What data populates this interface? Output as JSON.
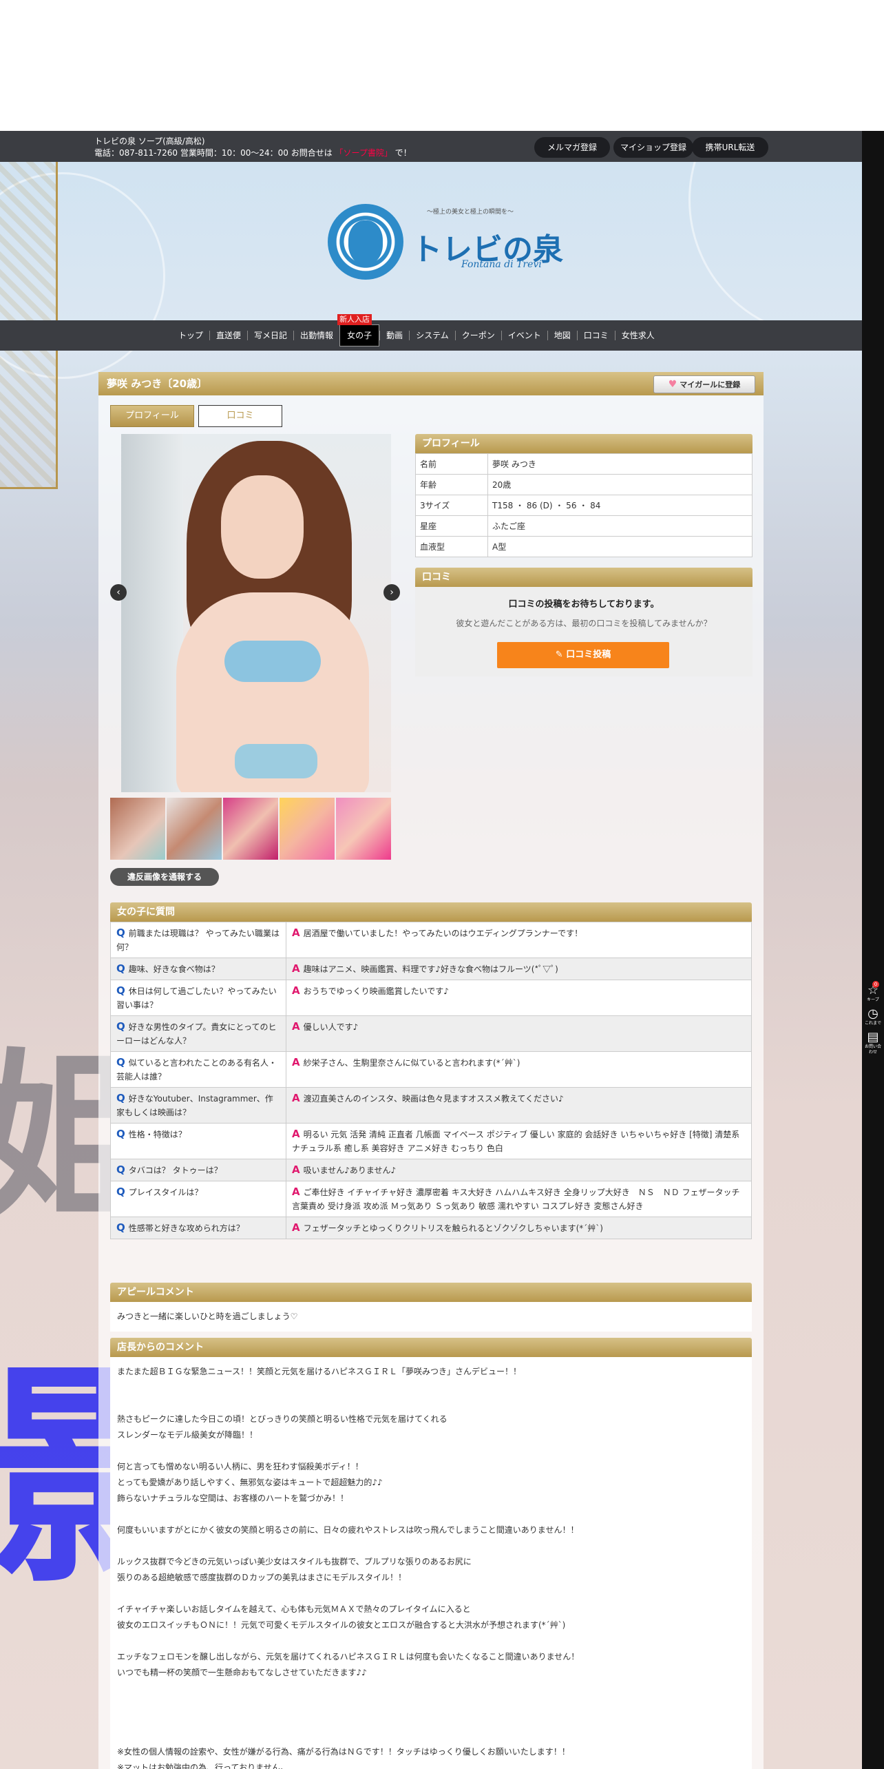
{
  "topbar": {
    "line1": "トレビの泉 ソープ(高級/高松)",
    "line2_prefix": "電話：087-811-7260 営業時間：10：00～24：00 お問合せは",
    "line2_highlight": "「ソープ書院」",
    "line2_suffix": "で！",
    "buttons": [
      "メルマガ登録",
      "マイショップ登録",
      "携帯URL転送"
    ]
  },
  "logo": {
    "tagline": "〜極上の美女と極上の瞬間を〜",
    "name": "トレビの泉",
    "en": "Fontana di Trevi"
  },
  "nav": {
    "items": [
      "トップ",
      "直送便",
      "写メ日記",
      "出勤情報",
      "女の子",
      "動画",
      "システム",
      "クーポン",
      "イベント",
      "地図",
      "口コミ",
      "女性求人"
    ],
    "new_badge": "新人入店"
  },
  "profile": {
    "title": "夢咲 みつき〔20歳〕",
    "mygirl_button": "マイガールに登録",
    "tabs": [
      "プロフィール",
      "口コミ"
    ],
    "report_button": "違反画像を通報する",
    "section_title": "プロフィール",
    "rows": [
      {
        "k": "名前",
        "v": "夢咲 みつき"
      },
      {
        "k": "年齢",
        "v": "20歳"
      },
      {
        "k": "3サイズ",
        "v": "T158 ・ 86 (D) ・ 56 ・ 84"
      },
      {
        "k": "星座",
        "v": "ふたご座"
      },
      {
        "k": "血液型",
        "v": "A型"
      }
    ]
  },
  "review": {
    "title": "口コミ",
    "message": "口コミの投稿をお待ちしております。",
    "sub": "彼女と遊んだことがある方は、最初の口コミを投稿してみませんか？",
    "button": "口コミ投稿"
  },
  "qa": {
    "title": "女の子に質問",
    "rows": [
      {
        "q": "前職または現職は？ やってみたい職業は何？",
        "a": "居酒屋で働いていました！やってみたいのはウエディングプランナーです！"
      },
      {
        "q": "趣味、好きな食べ物は？",
        "a": "趣味はアニメ、映画鑑賞、料理です♪好きな食べ物はフルーツ(*ﾟ▽ﾟ)"
      },
      {
        "q": "休日は何して過ごしたい？やってみたい習い事は？",
        "a": "おうちでゆっくり映画鑑賞したいです♪"
      },
      {
        "q": "好きな男性のタイプ。貴女にとってのヒーローはどんな人？",
        "a": "優しい人です♪"
      },
      {
        "q": "似ていると言われたことのある有名人・芸能人は誰？",
        "a": "紗栄子さん、生駒里奈さんに似ていると言われます(*´艸`)"
      },
      {
        "q": "好きなYoutuber、Instagrammer、作家もしくは映画は？",
        "a": "渡辺直美さんのインスタ、映画は色々見ますオススメ教えてください♪"
      },
      {
        "q": "性格・特徴は？",
        "a": "明るい 元気 活発 清純 正直者 几帳面 マイペース ポジティブ 優しい 家庭的 会話好き いちゃいちゃ好き [特徴] 清楚系 ナチュラル系 癒し系 美容好き アニメ好き むっちり 色白"
      },
      {
        "q": "タバコは？ タトゥーは？",
        "a": "吸いません♪ありません♪"
      },
      {
        "q": "プレイスタイルは？",
        "a": "ご奉仕好き イチャイチャ好き 濃厚密着 キス大好き ハムハムキス好き 全身リップ大好き　ＮＳ　ＮＤ フェザータッチ 言葉責め 受け身派 攻め派 Ｍっ気あり Ｓっ気あり 敏感 濡れやすい コスプレ好き 変態さん好き"
      },
      {
        "q": "性感帯と好きな攻められ方は？",
        "a": "フェザータッチとゆっくりクリトリスを触られるとゾクゾクしちゃいます(*´艸`)"
      }
    ]
  },
  "appeal": {
    "title": "アピールコメント",
    "text": "みつきと一緒に楽しいひと時を過ごしましょう♡"
  },
  "manager": {
    "title": "店長からのコメント",
    "text": "またまた超ＢＩＧな緊急ニュース！！笑顔と元気を届けるハピネスＧＩＲＬ「夢咲みつき」さんデビュー！！\n\n\n熱さもピークに達した今日この頃！とびっきりの笑顔と明るい性格で元気を届けてくれる\nスレンダーなモデル級美女が降臨！！\n\n何と言っても憎めない明るい人柄に、男を狂わす悩殺美ボディ！！\nとっても愛嬌があり話しやすく、無邪気な姿はキュートで超超魅力的♪♪\n飾らないナチュラルな空間は、お客様のハートを鷲づかみ！！\n\n何度もいいますがとにかく彼女の笑顔と明るさの前に、日々の疲れやストレスは吹っ飛んでしまうこと間違いありません！！\n\nルックス抜群で今どきの元気いっぱい美少女はスタイルも抜群で、プルプリな張りのあるお尻に\n張りのある超絶敏感で感度抜群のＤカップの美乳はまさにモデルスタイル！！\n\nイチャイチャ楽しいお話しタイムを越えて、心も体も元気ＭＡＸで熱々のプレイタイムに入ると\n彼女のエロスイッチもＯＮに！！元気で可愛くモデルスタイルの彼女とエロスが融合すると大洪水が予想されます(*´艸`)\n\nエッチなフェロモンを醸し出しながら、元気を届けてくれるハピネスＧＩＲＬは何度も会いたくなること間違いありません！\nいつでも精一杯の笑顔で一生懸命おもてなしさせていただきます♪♪\n\n\n\n\n※女性の個人情報の詮索や、女性が嫌がる行為、痛がる行為はＮＧです！！タッチはゆっくり優しくお願いいたします！！\n※マットはお勉強中の為、行っておりません。"
  },
  "sidebar": {
    "items": [
      "キープ",
      "これまで",
      "お問い合わせ"
    ],
    "badge": "0"
  }
}
